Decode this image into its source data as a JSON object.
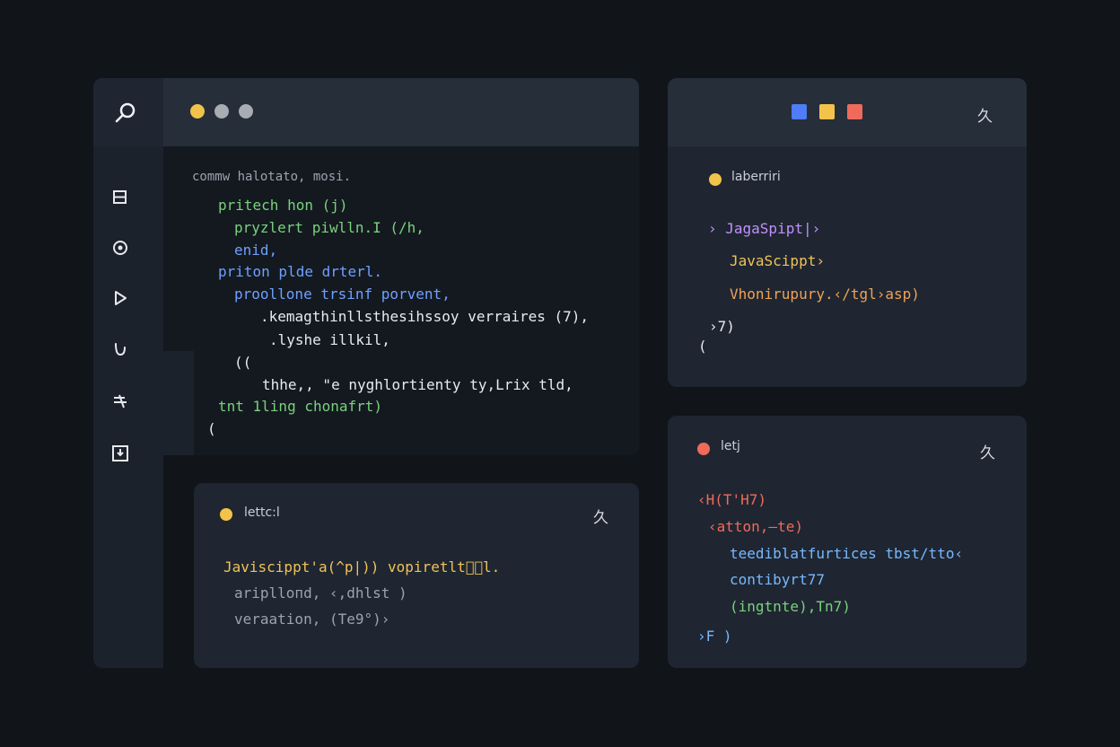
{
  "main_editor": {
    "header_line": "commw halotato, mosi.",
    "code": [
      {
        "text": "pritech hon (j)",
        "color": "green"
      },
      {
        "text": "pryzlert piwlln.I (/h,",
        "color": "green"
      },
      {
        "text": "enid,",
        "color": "blue"
      },
      {
        "text": "priton plde drterl.",
        "color": "blue"
      },
      {
        "text": "proollone trsinf porvent,",
        "color": "blue"
      },
      {
        "text": ".kemagthinllsthesihssoy verraires (7),",
        "color": "white"
      },
      {
        "text": ".lyshe illkil,",
        "color": "white"
      },
      {
        "text": "((",
        "color": "white"
      },
      {
        "text": "thhe,, \"e nyghlortienty ty,Lrix tld,",
        "color": "white"
      },
      {
        "text": "tnt 1ling chonafrt)",
        "color": "green"
      },
      {
        "text": "(",
        "color": "white"
      }
    ],
    "window_dots": [
      "#f2c34a",
      "#a8acb3",
      "#a8acb3"
    ]
  },
  "sidebar": {
    "icons": [
      "search-icon",
      "file-icon",
      "settings-icon",
      "run-icon",
      "branch-icon",
      "list-icon",
      "download-icon"
    ]
  },
  "bottom_left_panel": {
    "tab_label": "lettc:l",
    "lines": [
      {
        "text": "Javiscippt'a(^p|)) vopiretlt\u0000\u0000l.",
        "color": "yellow"
      },
      {
        "text": "ariplloпd, ‹,dhlst )",
        "color": "gray"
      },
      {
        "text": "veraation, (Te9°)›",
        "color": "gray"
      }
    ],
    "tool_glyph": "久"
  },
  "top_right_panel": {
    "tab_label": "laberriri",
    "swatches": [
      "#4f7cf7",
      "#f2c34a",
      "#f06a5c"
    ],
    "tool_glyph": "久",
    "lines": [
      {
        "text": "› JagaSpipt|›",
        "color": "purple"
      },
      {
        "text": "JavaScippt›",
        "color": "yellow"
      },
      {
        "text": "Vhonirupury.‹/tgl›asp)",
        "color": "orange"
      },
      {
        "text": "›7)",
        "color": "white"
      },
      {
        "text": "(",
        "color": "white"
      }
    ]
  },
  "bottom_right_panel": {
    "tab_label": "letj",
    "tool_glyph": "久",
    "lines": [
      {
        "text": "‹H(T'H7)",
        "color": "red"
      },
      {
        "text": "‹atton,–te)",
        "color": "red"
      },
      {
        "text": "teediblatfurtices tbst/tto‹",
        "color": "blue"
      },
      {
        "text": "contibyrt77",
        "color": "blue"
      },
      {
        "text": "(ingtnte),Tn7)",
        "color": "green"
      },
      {
        "text": "›F )",
        "color": "blue"
      }
    ]
  }
}
